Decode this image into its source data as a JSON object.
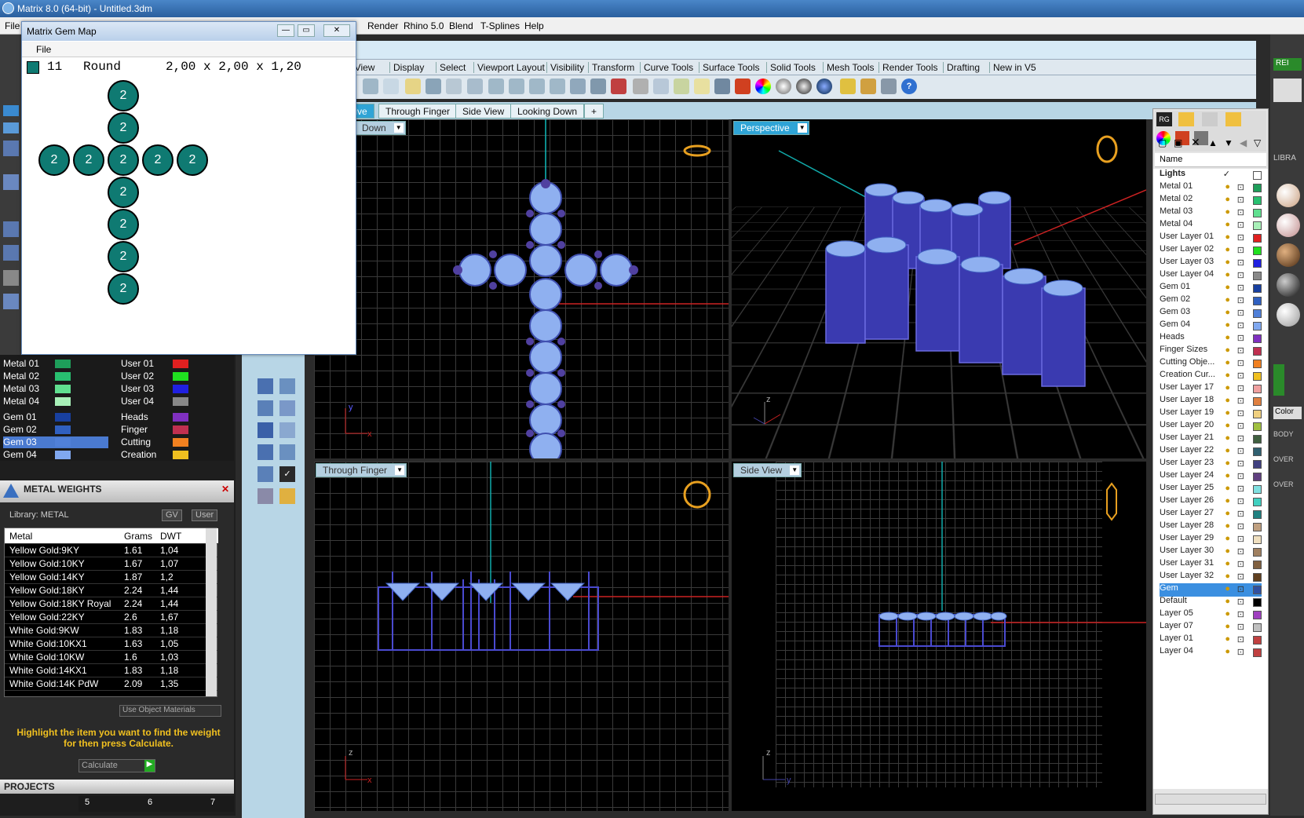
{
  "window": {
    "title": "Matrix 8.0 (64-bit) - Untitled.3dm"
  },
  "menubar": {
    "file": "File",
    "render": "Render",
    "rhino": "Rhino 5.0",
    "blend": "Blend",
    "tsplines": "T-Splines",
    "help": "Help"
  },
  "tooltabs": [
    "t View",
    "Display",
    "Select",
    "Viewport Layout",
    "Visibility",
    "Transform",
    "Curve Tools",
    "Surface Tools",
    "Solid Tools",
    "Mesh Tools",
    "Render Tools",
    "Drafting",
    "New in V5"
  ],
  "viewtabs": [
    "tive",
    "Through Finger",
    "Side View",
    "Looking Down",
    "+"
  ],
  "viewports": {
    "top": "Down",
    "perspective": "Perspective",
    "through_finger": "Through Finger",
    "side": "Side View"
  },
  "gemmap": {
    "title": "Matrix Gem Map",
    "menu_file": "File",
    "count": "11",
    "shape": "Round",
    "size": "2,00 x 2,00 x 1,20",
    "gem_label": "2"
  },
  "left": {
    "layers_left": [
      {
        "name": "Metal 01",
        "color": "#1e9e5a"
      },
      {
        "name": "Metal 02",
        "color": "#28c070"
      },
      {
        "name": "Metal 03",
        "color": "#60e090"
      },
      {
        "name": "Metal 04",
        "color": "#a8f0b8"
      },
      {
        "name": "Gem 01",
        "color": "#1840a0"
      },
      {
        "name": "Gem 02",
        "color": "#3060c0"
      },
      {
        "name": "Gem 03",
        "color": "#5080d8"
      },
      {
        "name": "Gem 04",
        "color": "#80a8f0"
      }
    ],
    "layers_right": [
      {
        "name": "User 01",
        "color": "#e02020"
      },
      {
        "name": "User 02",
        "color": "#20e020"
      },
      {
        "name": "User 03",
        "color": "#2020e0"
      },
      {
        "name": "User 04",
        "color": "#888888"
      },
      {
        "name": "Heads",
        "color": "#8030c0"
      },
      {
        "name": "Finger",
        "color": "#c03050"
      },
      {
        "name": "Cutting",
        "color": "#f08020"
      },
      {
        "name": "Creation",
        "color": "#f0c020"
      }
    ],
    "metal_weights": {
      "title": "METAL WEIGHTS",
      "library": "Library: METAL",
      "gv": "GV",
      "user": "User",
      "columns": [
        "Metal",
        "Grams",
        "DWT"
      ],
      "rows": [
        [
          "Yellow Gold:9KY",
          "1.61",
          "1,04"
        ],
        [
          "Yellow Gold:10KY",
          "1.67",
          "1,07"
        ],
        [
          "Yellow Gold:14KY",
          "1.87",
          "1,2"
        ],
        [
          "Yellow Gold:18KY",
          "2.24",
          "1,44"
        ],
        [
          "Yellow Gold:18KY Royal",
          "2.24",
          "1,44"
        ],
        [
          "Yellow Gold:22KY",
          "2.6",
          "1,67"
        ],
        [
          "White Gold:9KW",
          "1.83",
          "1,18"
        ],
        [
          "White Gold:10KX1",
          "1.63",
          "1,05"
        ],
        [
          "White Gold:10KW",
          "1.6",
          "1,03"
        ],
        [
          "White Gold:14KX1",
          "1.83",
          "1,18"
        ],
        [
          "White Gold:14K PdW",
          "2.09",
          "1,35"
        ]
      ],
      "use_object": "Use Object Materials",
      "hint": "Highlight the item you want to find the weight for then press Calculate.",
      "calculate": "Calculate"
    },
    "projects": "PROJECTS",
    "pager": [
      "5",
      "6",
      "7"
    ]
  },
  "rightlayers": {
    "header": "Name",
    "rows": [
      {
        "name": "Lights",
        "color": "#ffffff"
      },
      {
        "name": "Metal 01",
        "color": "#1e9e5a"
      },
      {
        "name": "Metal 02",
        "color": "#28c070"
      },
      {
        "name": "Metal 03",
        "color": "#60e090"
      },
      {
        "name": "Metal 04",
        "color": "#a8f0b8"
      },
      {
        "name": "User Layer 01",
        "color": "#e02020"
      },
      {
        "name": "User Layer 02",
        "color": "#20e020"
      },
      {
        "name": "User Layer 03",
        "color": "#2020e0"
      },
      {
        "name": "User Layer 04",
        "color": "#888888"
      },
      {
        "name": "Gem 01",
        "color": "#1840a0"
      },
      {
        "name": "Gem 02",
        "color": "#3060c0"
      },
      {
        "name": "Gem 03",
        "color": "#5080d8"
      },
      {
        "name": "Gem 04",
        "color": "#80a8f0"
      },
      {
        "name": "Heads",
        "color": "#8030c0"
      },
      {
        "name": "Finger Sizes",
        "color": "#c03050"
      },
      {
        "name": "Cutting Obje...",
        "color": "#f08020"
      },
      {
        "name": "Creation Cur...",
        "color": "#f0c020"
      },
      {
        "name": "User Layer 17",
        "color": "#f0a0a0"
      },
      {
        "name": "User Layer 18",
        "color": "#e08040"
      },
      {
        "name": "User Layer 19",
        "color": "#f0d080"
      },
      {
        "name": "User Layer 20",
        "color": "#a0c040"
      },
      {
        "name": "User Layer 21",
        "color": "#406040"
      },
      {
        "name": "User Layer 22",
        "color": "#306070"
      },
      {
        "name": "User Layer 23",
        "color": "#404080"
      },
      {
        "name": "User Layer 24",
        "color": "#604080"
      },
      {
        "name": "User Layer 25",
        "color": "#80e0e0"
      },
      {
        "name": "User Layer 26",
        "color": "#40d0c0"
      },
      {
        "name": "User Layer 27",
        "color": "#208080"
      },
      {
        "name": "User Layer 28",
        "color": "#c0a080"
      },
      {
        "name": "User Layer 29",
        "color": "#f0e0c0"
      },
      {
        "name": "User Layer 30",
        "color": "#a08060"
      },
      {
        "name": "User Layer 31",
        "color": "#806040"
      },
      {
        "name": "User Layer 32",
        "color": "#604020"
      },
      {
        "name": "Gem",
        "color": "#3050a0"
      },
      {
        "name": "Default",
        "color": "#000000"
      },
      {
        "name": "Layer 05",
        "color": "#a040c0"
      },
      {
        "name": "Layer 07",
        "color": "#c0c0c0"
      },
      {
        "name": "Layer 01",
        "color": "#c04040"
      },
      {
        "name": "Layer 04",
        "color": "#c04040"
      }
    ],
    "selected": "Gem"
  },
  "farright": {
    "libra": "LIBRA",
    "color": "Color",
    "body": "BODY",
    "over1": "OVER",
    "over2": "OVER"
  }
}
